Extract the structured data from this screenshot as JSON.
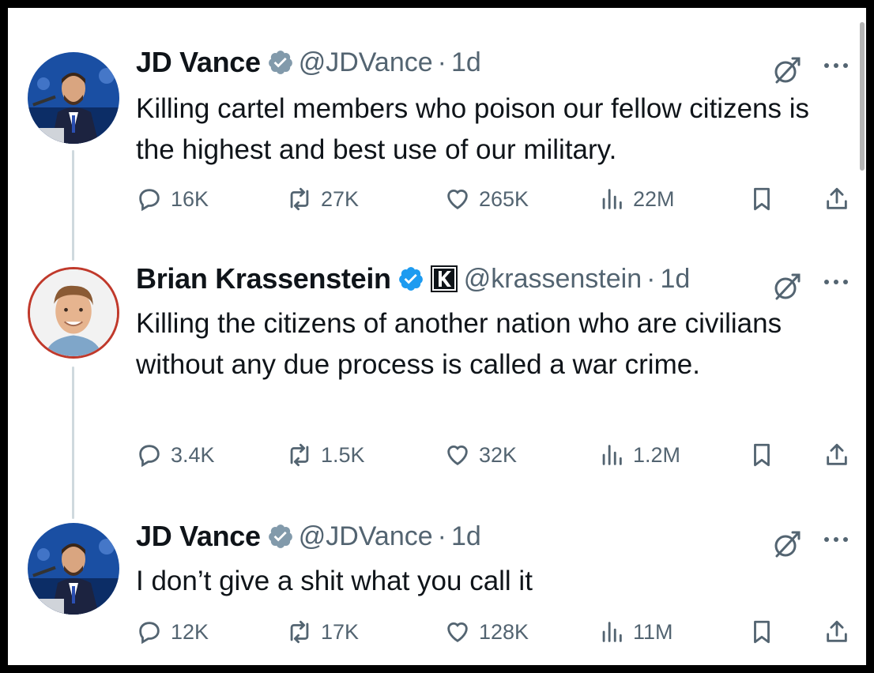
{
  "tweets": [
    {
      "name": "JD Vance",
      "handle": "@JDVance",
      "separator": "·",
      "time": "1d",
      "affiliation_badge": false,
      "text": "Killing cartel members who poison our fellow citizens is the highest and best use of our military.",
      "replies": "16K",
      "reposts": "27K",
      "likes": "265K",
      "views": "22M"
    },
    {
      "name": "Brian Krassenstein",
      "handle": "@krassenstein",
      "separator": "·",
      "time": "1d",
      "affiliation_badge": true,
      "text": "Killing the citizens of another nation who are civilians without any due process is called a war crime.",
      "replies": "3.4K",
      "reposts": "1.5K",
      "likes": "32K",
      "views": "1.2M"
    },
    {
      "name": "JD Vance",
      "handle": "@JDVance",
      "separator": "·",
      "time": "1d",
      "affiliation_badge": false,
      "text": "I don’t give a shit what you call it",
      "replies": "12K",
      "reposts": "17K",
      "likes": "128K",
      "views": "11M"
    }
  ],
  "colors": {
    "text": "#0f1419",
    "secondary": "#536471",
    "verified_gray": "#829aab",
    "verified_blue": "#1d9bf0",
    "thread_line": "#cfd9de"
  },
  "icons": {
    "verified": "verified-badge-icon",
    "grok": "grok-icon",
    "more": "more-options-icon",
    "reply": "reply-icon",
    "repost": "repost-icon",
    "like": "like-icon",
    "views": "views-icon",
    "bookmark": "bookmark-icon",
    "share": "share-icon"
  }
}
